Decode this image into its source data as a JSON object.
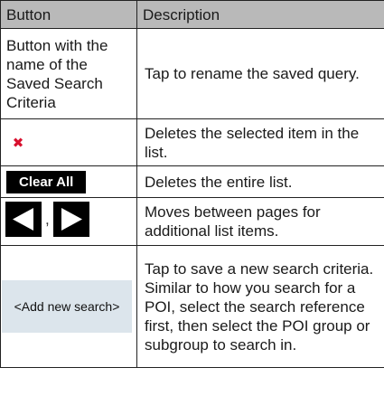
{
  "table": {
    "headers": [
      "Button",
      "Description"
    ],
    "rows": [
      {
        "button_text": "Button with the name of the Saved Search Criteria",
        "description": "Tap to rename the saved query."
      },
      {
        "button_icon": "delete-x-icon",
        "description": "Deletes the selected item in the list."
      },
      {
        "button_label": "Clear All",
        "description": "Deletes the entire list."
      },
      {
        "button_icons": [
          "arrow-left-icon",
          "arrow-right-icon"
        ],
        "separator": ",",
        "description": "Moves between pages for additional list items."
      },
      {
        "button_label": "<Add new search>",
        "description": "Tap to save a new search criteria. Similar to how you search for a POI, select the search reference first, then select the POI group or subgroup to search in."
      }
    ]
  },
  "colors": {
    "header_bg": "#b9b9b9",
    "delete_icon": "#d8102e",
    "dark_button": "#000000",
    "add_search_bg": "#dce5ec"
  }
}
